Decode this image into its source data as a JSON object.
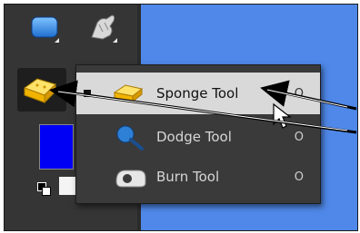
{
  "toolbox": {
    "top_left_icon": "rectangle-shape-icon",
    "top_right_icon": "smudge-finger-icon",
    "active_tool_icon": "sponge-icon",
    "foreground_color": "#0000f5",
    "background_color": "#ffffff"
  },
  "flyout": {
    "items": [
      {
        "label": "Sponge Tool",
        "shortcut": "O",
        "icon": "sponge-icon",
        "selected": true
      },
      {
        "label": "Dodge Tool",
        "shortcut": "O",
        "icon": "dodge-icon",
        "selected": false
      },
      {
        "label": "Burn Tool",
        "shortcut": "O",
        "icon": "burn-icon",
        "selected": false
      }
    ]
  },
  "canvas": {
    "color": "#4f88e8"
  },
  "annotation_arrows": {
    "color": "#000000",
    "count": 2
  }
}
